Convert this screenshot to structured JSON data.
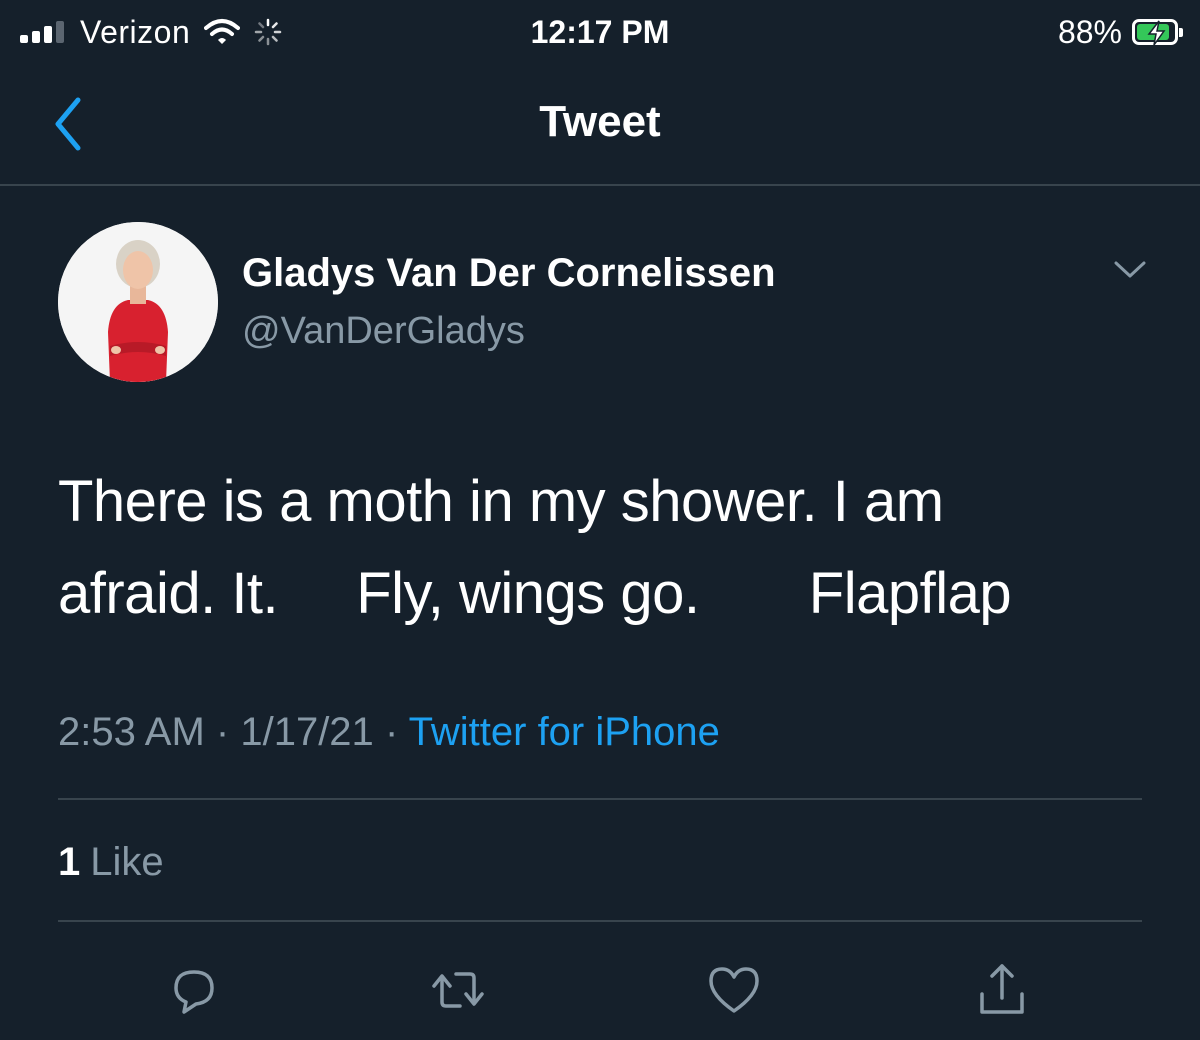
{
  "status_bar": {
    "carrier": "Verizon",
    "time": "12:17 PM",
    "battery_percent": "88%",
    "battery_level": 0.88,
    "battery_charging": true,
    "signal_bars": 3,
    "icons": [
      "signal-icon",
      "wifi-icon",
      "activity-spinner-icon",
      "battery-charging-icon"
    ]
  },
  "nav": {
    "title": "Tweet",
    "back_icon": "chevron-left-icon"
  },
  "tweet": {
    "author_name": "Gladys Van Der Cornelissen",
    "author_handle": "@VanDerGladys",
    "text_line1": "There is a moth in my shower. I am",
    "text_line2": "afraid. It.     Fly, wings go.       Flapflap",
    "time": "2:53 AM",
    "date": "1/17/21",
    "separator": "·",
    "source": "Twitter for iPhone",
    "like_count": "1",
    "like_label": "Like"
  },
  "actions": [
    {
      "name": "reply-icon"
    },
    {
      "name": "retweet-icon"
    },
    {
      "name": "like-icon"
    },
    {
      "name": "share-icon"
    }
  ],
  "colors": {
    "background": "#15202b",
    "accent": "#1da1f2",
    "secondary_text": "#8899a6",
    "divider": "#38444d",
    "battery_fill": "#34c759"
  }
}
